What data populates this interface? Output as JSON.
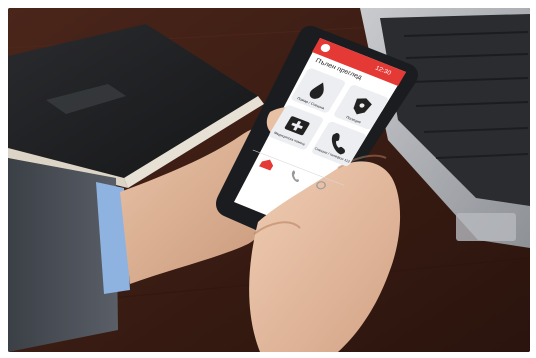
{
  "app": {
    "title": "Пълен преглед",
    "status": "12:30",
    "accent_color": "#e53935",
    "tiles": [
      {
        "label": "Пожар / Спешна",
        "icon": "fire-icon"
      },
      {
        "label": "Полиция",
        "icon": "police-badge-icon"
      },
      {
        "label": "Медицинска помощ",
        "icon": "first-aid-kit-icon"
      },
      {
        "label": "Спешни / телефон 112",
        "icon": "phone-icon"
      }
    ],
    "nav": [
      {
        "icon": "home-icon"
      },
      {
        "icon": "phone-nav-icon"
      },
      {
        "icon": "settings-nav-icon"
      }
    ]
  },
  "scene": {
    "objects": [
      "black-notebook",
      "laptop-keyboard",
      "smartphone",
      "hands",
      "wooden-desk"
    ]
  }
}
